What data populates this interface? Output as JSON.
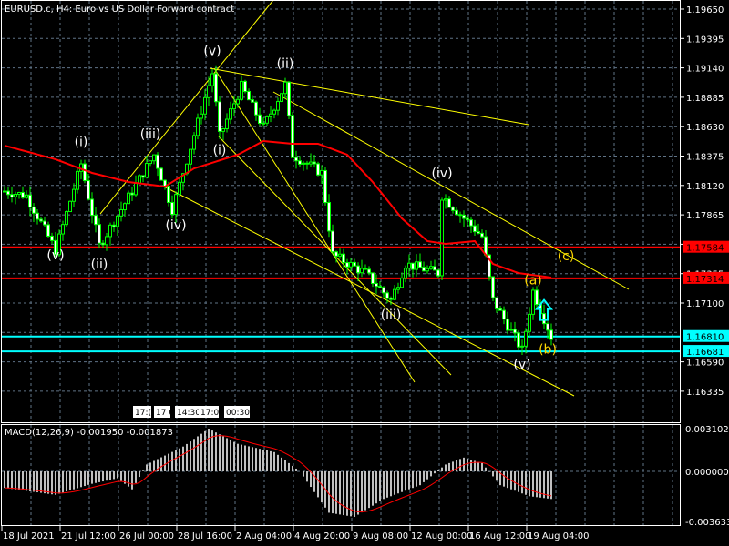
{
  "title": "EURUSD.c, H4:  Euro vs US Dollar Forward contract",
  "macd_label": "MACD(12,26,9) -0.001950 -0.001873",
  "price_axis": [
    "1.19650",
    "1.19395",
    "1.19140",
    "1.18885",
    "1.18630",
    "1.18375",
    "1.18120",
    "1.17865",
    "1.17610",
    "1.17355",
    "1.17100",
    "1.16590",
    "1.16335"
  ],
  "price_tags": [
    {
      "text": "1.17584",
      "price": 1.17584,
      "color": "#ff0000"
    },
    {
      "text": "1.17314",
      "price": 1.17314,
      "color": "#ff0000"
    },
    {
      "text": "1.16810",
      "price": 1.1681,
      "color": "#00ffff"
    },
    {
      "text": "1.16681",
      "price": 1.16681,
      "color": "#00ffff"
    }
  ],
  "macd_axis": [
    "0.003102",
    "0.000000",
    "-0.003633"
  ],
  "time_axis": [
    "18 Jul 2021",
    "21 Jul 12:00",
    "26 Jul 00:00",
    "28 Jul 16:00",
    "2 Aug 04:00",
    "4 Aug 20:00",
    "9 Aug 08:00",
    "12 Aug 00:00",
    "16 Aug 12:00",
    "19 Aug 04:00"
  ],
  "session_markers": [
    "17:(",
    "17 0",
    "14:30",
    "17:0",
    "00:30"
  ],
  "chart_data": {
    "type": "candlestick",
    "symbol": "EURUSD.c",
    "timeframe": "H4",
    "ylim": [
      1.162,
      1.1975
    ],
    "pivots": [
      [
        0,
        1.18071
      ],
      [
        6,
        1.18032
      ],
      [
        14,
        1.17558
      ],
      [
        21,
        1.18308
      ],
      [
        26,
        1.17597
      ],
      [
        41,
        1.18387
      ],
      [
        46,
        1.17913
      ],
      [
        57,
        1.19097
      ],
      [
        59,
        1.18545
      ],
      [
        65,
        1.18979
      ],
      [
        71,
        1.18624
      ],
      [
        77,
        1.18995
      ],
      [
        79,
        1.18387
      ],
      [
        87,
        1.18229
      ],
      [
        90,
        1.17518
      ],
      [
        99,
        1.1736
      ],
      [
        106,
        1.17124
      ],
      [
        110,
        1.17439
      ],
      [
        119,
        1.1736
      ],
      [
        120,
        1.18032
      ],
      [
        131,
        1.17676
      ],
      [
        134,
        1.17124
      ],
      [
        142,
        1.1669
      ],
      [
        145,
        1.17203
      ],
      [
        150,
        1.16808
      ]
    ],
    "moving_average": [
      [
        0,
        1.18466
      ],
      [
        14,
        1.18347
      ],
      [
        24,
        1.18229
      ],
      [
        34,
        1.1815
      ],
      [
        44,
        1.1811
      ],
      [
        52,
        1.18268
      ],
      [
        64,
        1.18387
      ],
      [
        71,
        1.18505
      ],
      [
        79,
        1.18482
      ],
      [
        86,
        1.18482
      ],
      [
        94,
        1.18387
      ],
      [
        101,
        1.1815
      ],
      [
        109,
        1.17834
      ],
      [
        116,
        1.17637
      ],
      [
        121,
        1.17613
      ],
      [
        129,
        1.17637
      ],
      [
        134,
        1.17439
      ],
      [
        141,
        1.1736
      ],
      [
        150,
        1.17321
      ]
    ],
    "macd_hist": [
      [
        0,
        -0.0012
      ],
      [
        14,
        -0.0017
      ],
      [
        19,
        -0.0013
      ],
      [
        24,
        -0.0009
      ],
      [
        31,
        -0.0005
      ],
      [
        35,
        -0.0013
      ],
      [
        39,
        0.0005
      ],
      [
        49,
        0.0018
      ],
      [
        56,
        0.0031
      ],
      [
        64,
        0.002
      ],
      [
        74,
        0.0014
      ],
      [
        81,
        0.0
      ],
      [
        89,
        -0.003
      ],
      [
        96,
        -0.0033
      ],
      [
        104,
        -0.002
      ],
      [
        114,
        -0.001
      ],
      [
        121,
        0.0005
      ],
      [
        126,
        0.001
      ],
      [
        131,
        0.0006
      ],
      [
        136,
        -0.001
      ],
      [
        144,
        -0.0018
      ],
      [
        150,
        -0.002
      ]
    ],
    "macd_range": [
      -0.003633,
      0.003102
    ],
    "horizontal_levels": [
      1.17584,
      1.17314,
      1.1681,
      1.16681
    ],
    "wave_labels": [
      {
        "text": "(v)",
        "bar": 14,
        "price": 1.1748,
        "color": "#ffffff"
      },
      {
        "text": "(i)",
        "bar": 21,
        "price": 1.1846,
        "color": "#ffffff"
      },
      {
        "text": "(ii)",
        "bar": 26,
        "price": 1.174,
        "color": "#ffffff"
      },
      {
        "text": "(iii)",
        "bar": 40,
        "price": 1.1853,
        "color": "#ffffff"
      },
      {
        "text": "(iv)",
        "bar": 47,
        "price": 1.1774,
        "color": "#ffffff"
      },
      {
        "text": "(v)",
        "bar": 57,
        "price": 1.1925,
        "color": "#ffffff"
      },
      {
        "text": "(i)",
        "bar": 59,
        "price": 1.1839,
        "color": "#ffffff"
      },
      {
        "text": "(ii)",
        "bar": 77,
        "price": 1.1914,
        "color": "#ffffff"
      },
      {
        "text": "(iii)",
        "bar": 106,
        "price": 1.1696,
        "color": "#ffffff"
      },
      {
        "text": "(iv)",
        "bar": 120,
        "price": 1.1819,
        "color": "#ffffff"
      },
      {
        "text": "(v)",
        "bar": 142,
        "price": 1.1653,
        "color": "#ffffff"
      },
      {
        "text": "(a)",
        "bar": 145,
        "price": 1.1726,
        "color": "#ffd700"
      },
      {
        "text": "(b)",
        "bar": 149,
        "price": 1.1666,
        "color": "#ffd700"
      },
      {
        "text": "(c)",
        "bar": 154,
        "price": 1.1747,
        "color": "#ffd700"
      }
    ],
    "arrow": {
      "direction": "up",
      "bar": 148,
      "color": "#00ffff"
    }
  }
}
